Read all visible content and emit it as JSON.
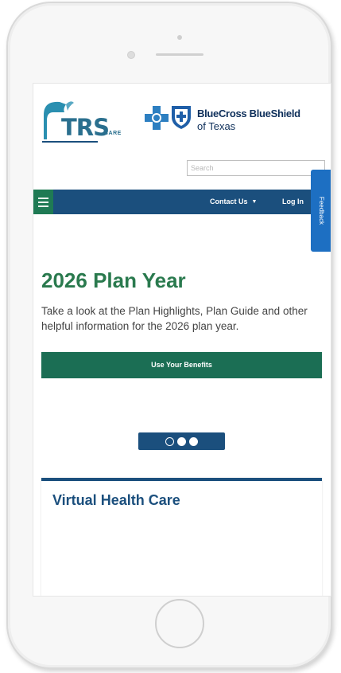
{
  "header": {
    "trs_logo_text": "TRS",
    "trs_logo_sub": "CARE",
    "bcbs_name": "BlueCross BlueShield",
    "bcbs_state": "of Texas"
  },
  "search": {
    "placeholder": "Search"
  },
  "nav": {
    "contact_label": "Contact Us",
    "login_label": "Log In",
    "feedback_label": "Feedback"
  },
  "hero": {
    "title": "2026 Plan Year",
    "text": "Take a look at the Plan Highlights, Plan Guide and other helpful information for the 2026 plan year.",
    "cta_label": "Use Your Benefits"
  },
  "carousel": {
    "slide_count": 3,
    "active_index": 0
  },
  "card": {
    "title": "Virtual Health Care"
  },
  "colors": {
    "brand_green": "#2a7a4e",
    "nav_blue": "#1b4f7d",
    "cta_green": "#1b6e54",
    "feedback_blue": "#1d6fc2"
  }
}
